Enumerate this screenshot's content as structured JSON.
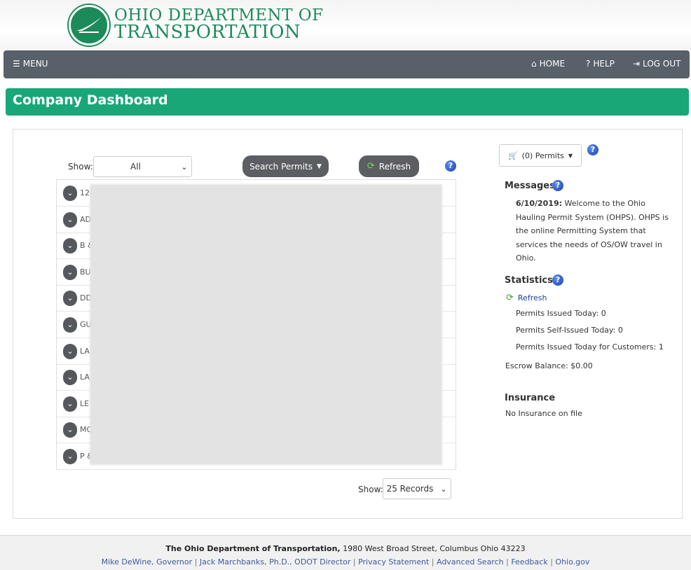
{
  "header": {
    "logo_line1": "OHIO DEPARTMENT OF",
    "logo_line2": "TRANSPORTATION"
  },
  "navbar": {
    "menu": "MENU",
    "home": "HOME",
    "help": "HELP",
    "logout": "LOG OUT"
  },
  "page_title": "Company Dashboard",
  "toolbar": {
    "show_label": "Show:",
    "show_value": "All",
    "search_permits": "Search Permits",
    "refresh": "Refresh"
  },
  "company_rows": [
    {
      "text": "1247943 ONTARIO LTD D/B/A JNB HEAVY HAUL - 2"
    },
    {
      "text": "AD"
    },
    {
      "text": "B &"
    },
    {
      "text": "BU"
    },
    {
      "text": "DD"
    },
    {
      "text": "GU"
    },
    {
      "text": "LA"
    },
    {
      "text": "LA"
    },
    {
      "text": "LE"
    },
    {
      "text": "MO"
    },
    {
      "text": "P & C INDUSTRIAL SERVICES LLC - 1"
    }
  ],
  "pagination": {
    "show_label": "Show:",
    "records_value": "25 Records"
  },
  "cart": {
    "label": "(0) Permits"
  },
  "messages": {
    "title": "Messages",
    "date": "6/10/2019:",
    "body": "Welcome to the Ohio Hauling Permit System (OHPS). OHPS is the online Permitting System that services the needs of OS/OW travel in Ohio."
  },
  "statistics": {
    "title": "Statistics",
    "refresh": "Refresh",
    "issued_today": "Permits Issued Today: 0",
    "self_issued_today": "Permits Self-Issued Today: 0",
    "issued_for_customers": "Permits Issued Today for Customers: 1",
    "escrow": "Escrow Balance: $0.00"
  },
  "insurance": {
    "title": "Insurance",
    "status": "No Insurance on file"
  },
  "footer": {
    "org": "The Ohio Department of Transportation,",
    "address": "1980 West Broad Street, Columbus Ohio 43223",
    "links": [
      "Mike DeWine, Governor",
      "Jack Marchbanks, Ph.D., ODOT Director",
      "Privacy Statement",
      "Advanced Search",
      "Feedback",
      "Ohio.gov"
    ]
  },
  "colors": {
    "brand_green": "#1d8a5a",
    "dashboard_bar": "#1aa777",
    "navbar": "#58606a"
  }
}
